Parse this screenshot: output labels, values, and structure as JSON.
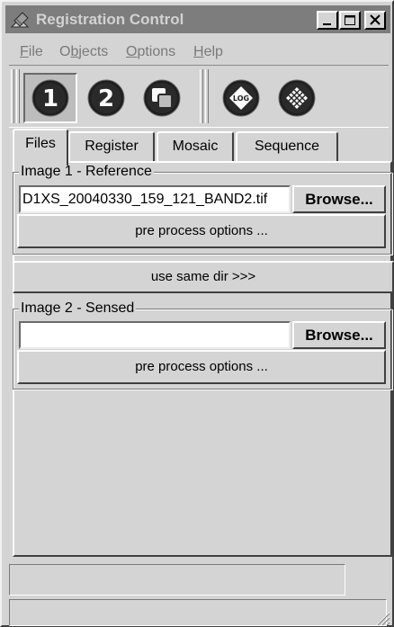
{
  "window": {
    "title": "Registration Control",
    "title_bar_color": "#7d7d7d",
    "controls": [
      {
        "name": "minimize",
        "icon": "minimize-icon"
      },
      {
        "name": "maximize",
        "icon": "maximize-icon"
      },
      {
        "name": "close",
        "icon": "close-icon"
      }
    ]
  },
  "menu": {
    "items": [
      {
        "label": "File",
        "mnemonic": "F"
      },
      {
        "label": "Objects",
        "mnemonic": "b"
      },
      {
        "label": "Options",
        "mnemonic": "O"
      },
      {
        "label": "Help",
        "mnemonic": "H"
      }
    ]
  },
  "toolbar": {
    "buttons": [
      {
        "icon": "step-1-icon",
        "label": "1",
        "pressed": true
      },
      {
        "icon": "step-2-icon",
        "label": "2",
        "pressed": false
      },
      {
        "icon": "overlay-icon",
        "pressed": false
      },
      {
        "icon": "log-icon",
        "label": "LOG",
        "pressed": false
      },
      {
        "icon": "grid-icon",
        "pressed": false
      }
    ]
  },
  "tabs": [
    {
      "label": "Files",
      "active": true
    },
    {
      "label": "Register",
      "active": false
    },
    {
      "label": "Mosaic",
      "active": false
    },
    {
      "label": "Sequence",
      "active": false
    }
  ],
  "image1": {
    "group_title": "Image 1 - Reference",
    "path_value": "D1XS_20040330_159_121_BAND2.tif",
    "browse_label": "Browse...",
    "preprocess_label": "pre process options ..."
  },
  "same_dir_label": "use same dir >>>",
  "image2": {
    "group_title": "Image 2 - Sensed",
    "path_value": "",
    "browse_label": "Browse...",
    "preprocess_label": "pre process options ..."
  },
  "status": {
    "field1": "",
    "field2": ""
  }
}
